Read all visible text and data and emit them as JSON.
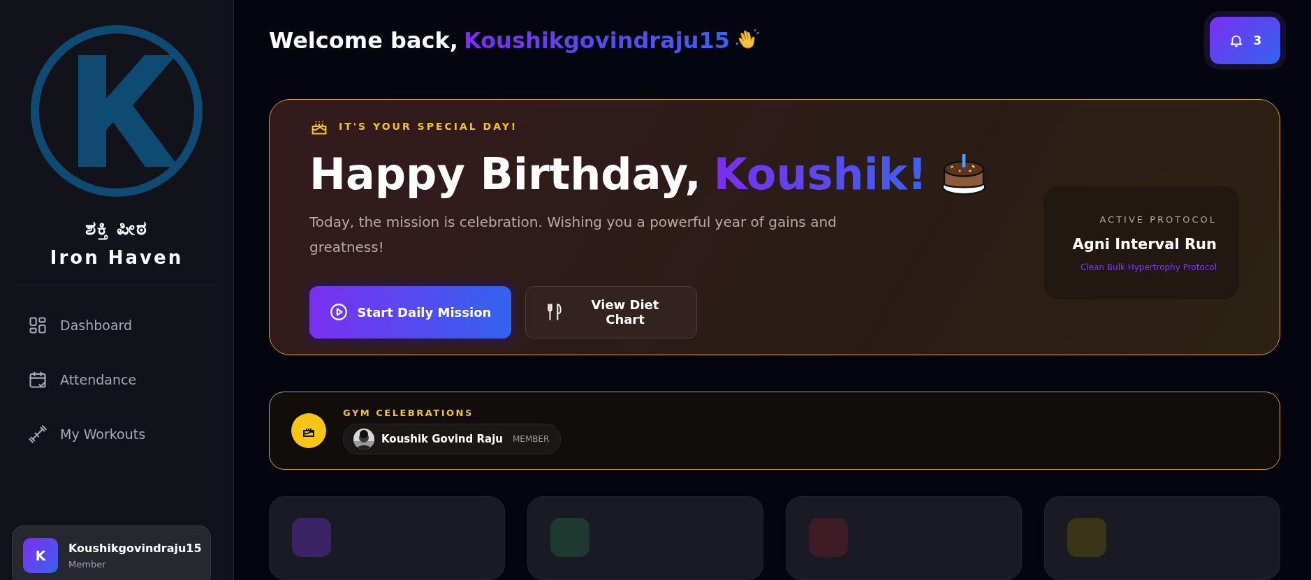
{
  "sidebar": {
    "brand": {
      "native_name": "ಶಕ್ತಿ ಪೀಠ",
      "name": "Iron Haven"
    },
    "items": [
      {
        "label": "Dashboard",
        "kind": "dashboard",
        "selected": false
      },
      {
        "label": "Attendance",
        "kind": "attendance",
        "selected": false
      },
      {
        "label": "My Workouts",
        "kind": "workouts",
        "selected": false
      }
    ],
    "user": {
      "initial": "K",
      "name": "Koushikgovindraju15",
      "role": "Member"
    }
  },
  "header": {
    "greeting": "Welcome back,",
    "name": "Koushikgovindraju15",
    "notifications": "3"
  },
  "birthday_banner": {
    "eyebrow": "IT'S YOUR SPECIAL DAY!",
    "title": "Happy Birthday,",
    "name": "Koushik!",
    "message": "Today, the mission is celebration. Wishing you a powerful year of gains and greatness!",
    "buttons": [
      {
        "label": "Start Daily Mission",
        "kind": "primary"
      },
      {
        "label": "View Diet Chart",
        "kind": "secondary"
      }
    ],
    "protocol": {
      "label": "ACTIVE PROTOCOL",
      "name": "Agni Interval Run",
      "plan": "Clean Bulk Hypertrophy Protocol"
    }
  },
  "celebrations": {
    "title": "GYM CELEBRATIONS",
    "people": [
      {
        "name": "Koushik Govind Raju",
        "role": "MEMBER"
      }
    ]
  },
  "stat_cards": [
    {
      "color": "#3a2466"
    },
    {
      "color": "#1c3a30"
    },
    {
      "color": "#3d1c26"
    },
    {
      "color": "#3a3418"
    }
  ]
}
